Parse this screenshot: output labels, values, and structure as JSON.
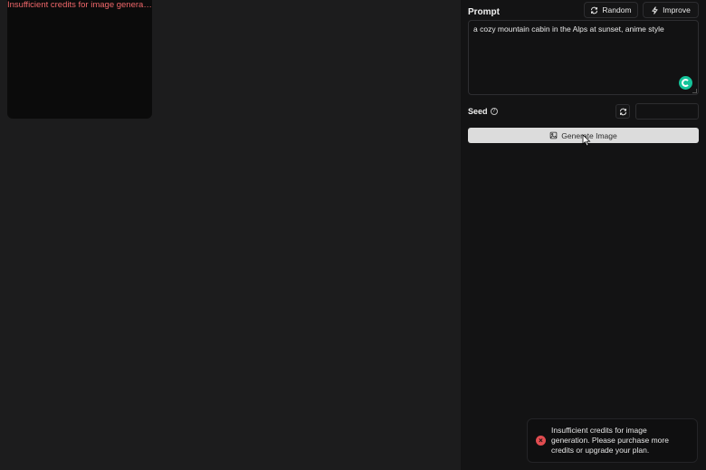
{
  "gallery": {
    "error_text": "Insufficient credits for image generatio..."
  },
  "sidebar": {
    "prompt_label": "Prompt",
    "random_label": "Random",
    "improve_label": "Improve",
    "prompt_value": "a cozy mountain cabin in the Alps at sunset, anime style",
    "seed_label": "Seed",
    "seed_value": "",
    "generate_label": "Generate Image"
  },
  "toast": {
    "message": "Insufficient credits for image generation. Please purchase more credits or upgrade your plan."
  },
  "colors": {
    "error_red": "#e14c50",
    "grammarly_green": "#15c39a"
  }
}
